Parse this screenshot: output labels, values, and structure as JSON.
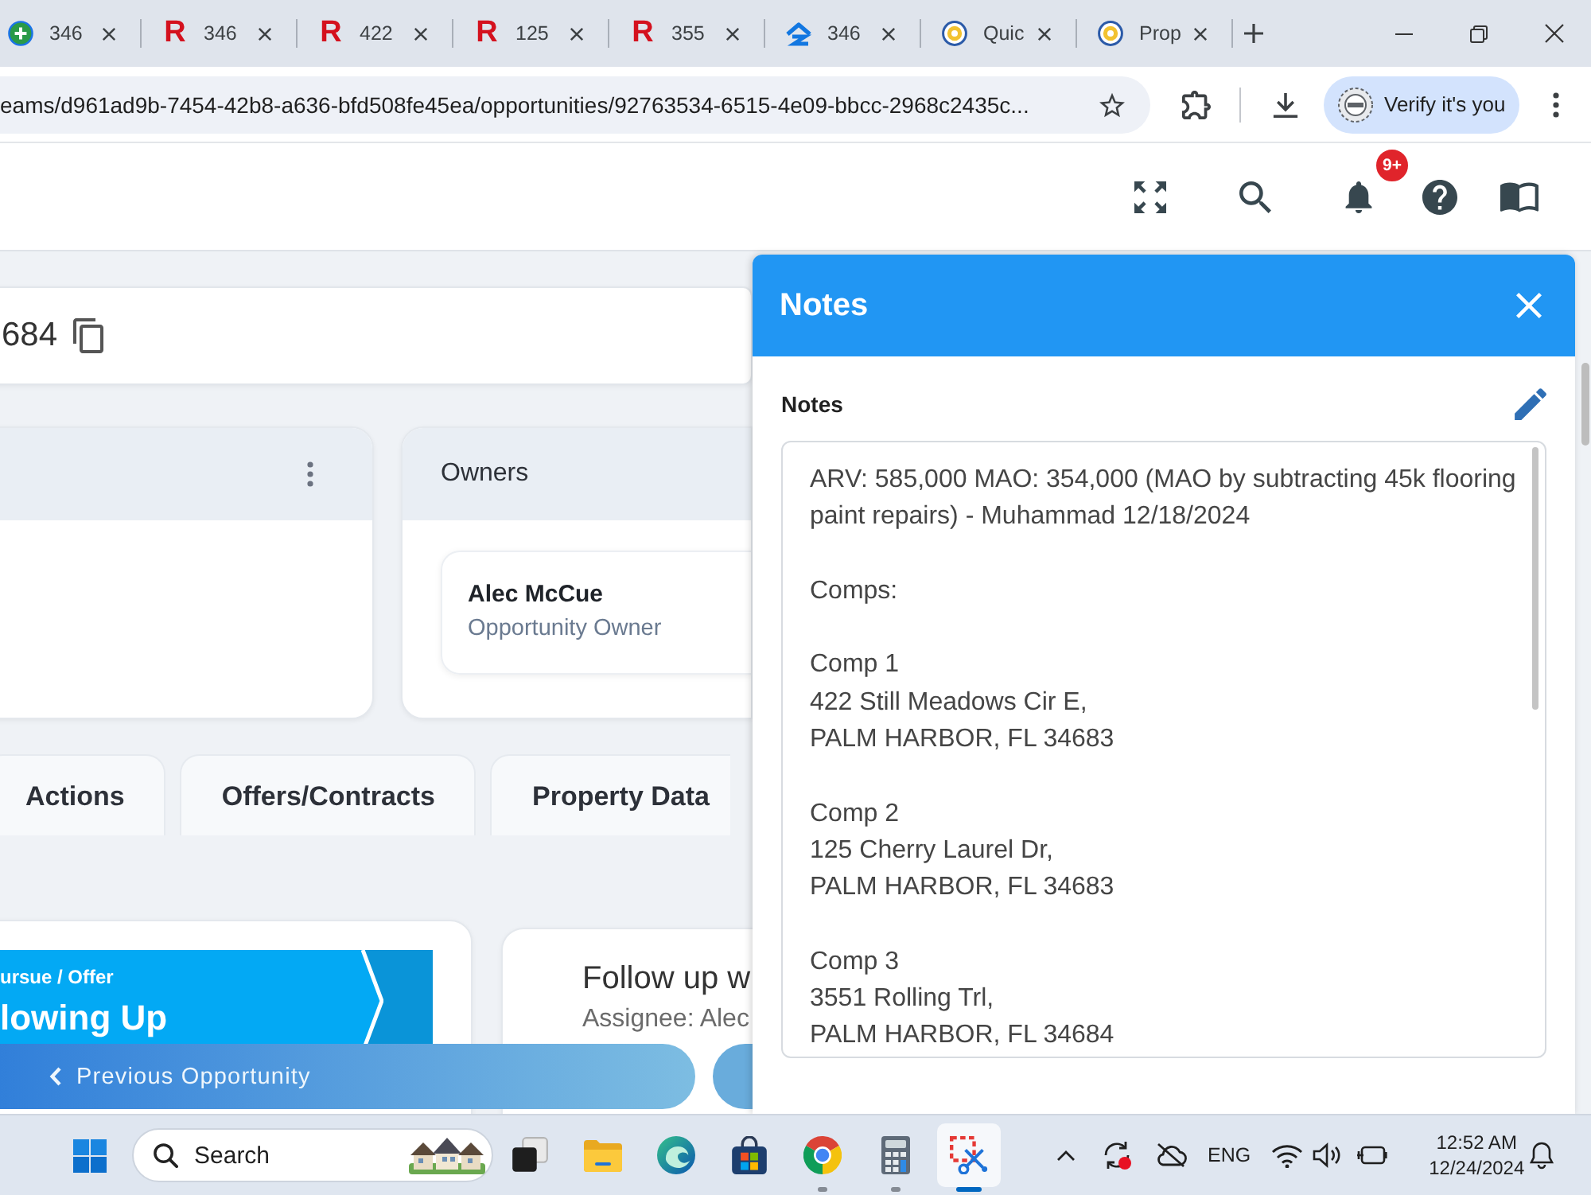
{
  "browser": {
    "tabs": [
      {
        "kind": "plus-circle",
        "title": "346"
      },
      {
        "kind": "letter",
        "letter": "R",
        "title": "346"
      },
      {
        "kind": "letter",
        "letter": "R",
        "title": "422"
      },
      {
        "kind": "letter",
        "letter": "R",
        "title": "125"
      },
      {
        "kind": "letter",
        "letter": "R",
        "title": "355"
      },
      {
        "kind": "house",
        "title": "346"
      },
      {
        "kind": "round-logo",
        "title": "Quic"
      },
      {
        "kind": "round-logo",
        "title": "Prop"
      }
    ],
    "url": "eams/d961ad9b-7454-42b8-a636-bfd508fe45ea/opportunities/92763534-6515-4e09-bbcc-2968c2435c...",
    "profile_label": "Verify it's you"
  },
  "app_header": {
    "notification_count": "9+"
  },
  "page": {
    "address_fragment": "684",
    "owners": {
      "title": "Owners",
      "name": "Alec McCue",
      "role": "Opportunity Owner"
    },
    "tabs": [
      {
        "label": "Actions",
        "selected": false
      },
      {
        "label": "Offers/Contracts",
        "selected": false
      },
      {
        "label": "Property Data",
        "selected": false
      }
    ],
    "stage": {
      "pipeline": "ursue / Offer",
      "status": "lowing Up"
    },
    "task": {
      "title": "Follow up w",
      "assignee": "Assignee: Alec"
    },
    "footer": {
      "previous": "Previous Opportunity"
    }
  },
  "notes_panel": {
    "title": "Notes",
    "label": "Notes",
    "text": "ARV: 585,000 MAO: 354,000 (MAO by subtracting 45k flooring paint repairs) - Muhammad 12/18/2024\n\nComps:\n\nComp 1\n422 Still Meadows Cir E,\nPALM HARBOR, FL 34683\n\nComp 2\n125 Cherry Laurel Dr,\nPALM HARBOR, FL 34683\n\nComp 3\n3551 Rolling Trl,\nPALM HARBOR, FL 34684"
  },
  "taskbar": {
    "search_label": "Search",
    "apps": [
      {
        "kind": "squares",
        "open": false,
        "selected": false
      },
      {
        "kind": "folder",
        "open": false,
        "selected": false
      },
      {
        "kind": "swirl",
        "open": false,
        "selected": false
      },
      {
        "kind": "bag",
        "open": false,
        "selected": false
      },
      {
        "kind": "wheel",
        "open": true,
        "selected": false
      },
      {
        "kind": "calculator",
        "open": true,
        "selected": false
      },
      {
        "kind": "scissors",
        "open": true,
        "selected": true
      }
    ],
    "language": "ENG",
    "time": "12:52 AM",
    "date": "12/24/2024"
  }
}
